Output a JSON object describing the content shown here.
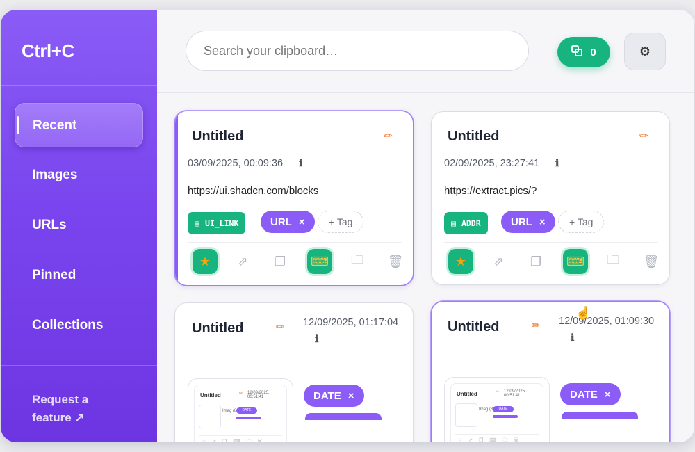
{
  "app": {
    "brand": "Ctrl+C"
  },
  "sidebar": {
    "items": [
      {
        "label": "Recent",
        "active": true
      },
      {
        "label": "Images",
        "active": false
      },
      {
        "label": "URLs",
        "active": false
      },
      {
        "label": "Pinned",
        "active": false
      },
      {
        "label": "Collections",
        "active": false
      }
    ],
    "request_label": "Request a feature ↗"
  },
  "search": {
    "placeholder": "Search your clipboard…"
  },
  "selection": {
    "count": "0",
    "icon": "multi-select-icon"
  },
  "settings": {
    "icon": "gear-icon"
  },
  "cards": [
    {
      "title": "Untitled",
      "date": "03/09/2025, 00:09:36",
      "content": "https://ui.shadcn.com/blocks",
      "type_tag": "UI_LINK",
      "tags": [
        "URL"
      ],
      "add_tag": "+ Tag"
    },
    {
      "title": "Untitled",
      "date": "02/09/2025, 23:27:41",
      "content": "https://extract.pics/?",
      "type_tag": "ADDR",
      "tags": [
        "URL"
      ],
      "add_tag": "+ Tag"
    },
    {
      "title": "Untitled",
      "date": "12/09/2025, 01:17:04",
      "tags": [
        "DATE"
      ],
      "thumb": {
        "title": "Untitled",
        "date": "12/09/2025, 00:51:41",
        "tag": "DATE",
        "label": "Imag (820×"
      }
    },
    {
      "title": "Untitled",
      "date": "12/09/2025, 01:09:30",
      "tags": [
        "DATE"
      ],
      "thumb": {
        "title": "Untitled",
        "date": "12/09/2025, 00:51:41",
        "tag": "DATE",
        "label": "Imag (820×"
      }
    }
  ],
  "colors": {
    "accent": "#8b5cf6",
    "green": "#17b47f",
    "edit": "#f0782a"
  }
}
